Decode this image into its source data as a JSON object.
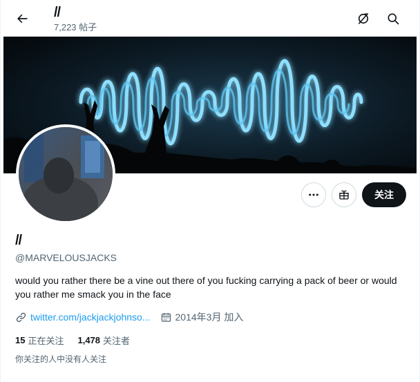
{
  "header": {
    "title": "//",
    "post_count": "7,223 帖子"
  },
  "profile": {
    "display_name": "//",
    "handle": "@MARVELOUSJACKS",
    "bio": "would you rather there be a vine out there of you fucking carrying a pack of beer or would you rather me smack you in the face",
    "website": "twitter.com/jackjackjohnso...",
    "joined": "2014年3月 加入",
    "following_count": "15",
    "following_label": "正在关注",
    "followers_count": "1,478",
    "followers_label": "关注者",
    "known_followers": "你关注的人中没有人关注"
  },
  "actions": {
    "follow_label": "关注"
  },
  "icons": {
    "back": "arrow-left-icon",
    "grok": "grok-icon",
    "search": "search-icon",
    "more": "more-icon",
    "subscribe": "gift-icon",
    "link": "link-icon",
    "calendar": "calendar-icon"
  },
  "colors": {
    "accent": "#1d9bf0",
    "text": "#0f1419",
    "secondary": "#536471",
    "follow_bg": "#0f1419",
    "banner_glow": "#7fd6ff"
  }
}
